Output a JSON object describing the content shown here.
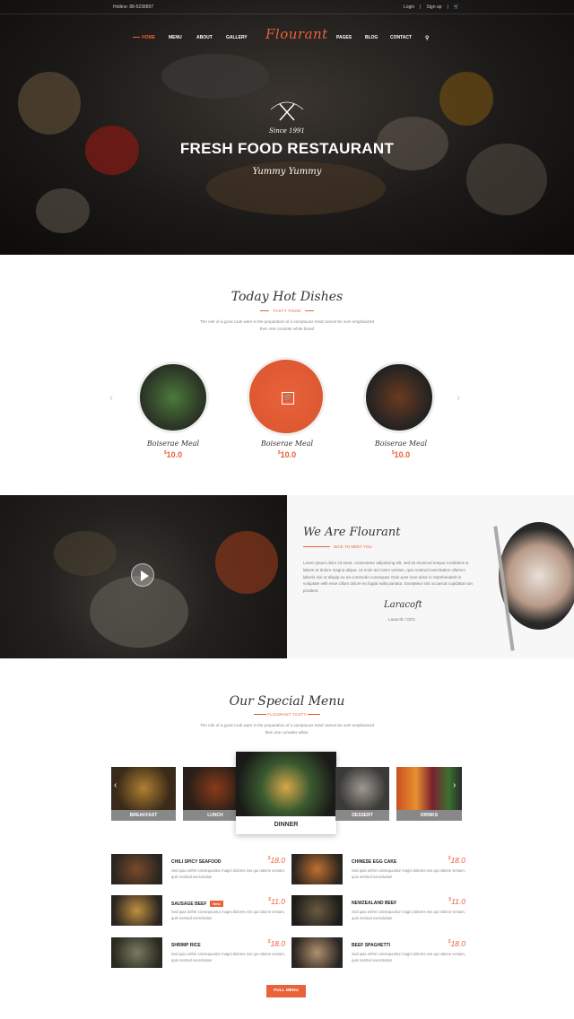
{
  "topbar": {
    "hotline": "Hotline: 88-6238897",
    "login": "Login",
    "signup": "Sign up"
  },
  "nav": {
    "items": [
      "HOME",
      "MENU",
      "ABOUT",
      "GALLERY",
      "PAGES",
      "BLOG",
      "CONTACT"
    ],
    "logo": "Flourant"
  },
  "hero": {
    "since": "Since  1991",
    "title": "FRESH FOOD RESTAURANT",
    "tagline": "Yummy Yummy"
  },
  "hot": {
    "title": "Today Hot Dishes",
    "subtitle": "TASTY FOOD",
    "desc": "The role of a good cook ware in the preparation of a sumptuous meal cannot be over emphasized then one consider white bread",
    "dishes": [
      {
        "name": "Boiserae Meal",
        "price": "10.0",
        "currency": "$"
      },
      {
        "name": "Boiserae Meal",
        "price": "10.0",
        "currency": "$"
      },
      {
        "name": "Boiserae Meal",
        "price": "10.0",
        "currency": "$"
      }
    ]
  },
  "about": {
    "title": "We Are Flourant",
    "subtitle": "NICE TO MEET YOU",
    "text": "Lorem ipsum dolor sit amet, consectetur adipisicing elit, sed do eiusmod tempor incididunt ut labore et dolore magna aliqua. Ut enim ad minim veniam, quis nostrud exercitation ullamco laboris nisi ut aliquip ex ea commodo consequat. Duis aute irure dolor in reprehenderit in voluptate velit esse cillum dolore eu fugiat nulla pariatur. Excepteur sint occaecat cupidatat non proident.",
    "signature": "Laracoft",
    "ceo": "Laracoft / CEO"
  },
  "special": {
    "title": "Our Special Menu",
    "subtitle": "FLOURANT TASTY",
    "desc": "The role of a good cook ware in the preparation of a sumptuous meal cannot be over emphasized then one consider white.",
    "tabs": [
      "BREAKFAST",
      "LUNCH",
      "DINNER",
      "DESSERT",
      "DRINKS"
    ],
    "items": [
      {
        "name": "CHILI SPICY SEAFOOD",
        "price": "18.0",
        "desc": "Sed quia onfret consequuntur magni dolores eos qui ratione veniam, quis nostrud exercitation",
        "new": ""
      },
      {
        "name": "CHINESE EGG CAKE",
        "price": "18.0",
        "desc": "Sed quia onfret consequuntur magni dolores eos qui ratione veniam, quis nostrud exercitation",
        "new": ""
      },
      {
        "name": "SAUSAGE BEEF",
        "price": "11.0",
        "desc": "Sed quia onfret consequuntur magni dolores eos qui ratione veniam, quis nostrud exercitation",
        "new": "New"
      },
      {
        "name": "NEWZEALAND BEEF",
        "price": "11.0",
        "desc": "Sed quia onfret consequuntur magni dolores eos qui ratione veniam, quis nostrud exercitation",
        "new": ""
      },
      {
        "name": "SHRIMP RICE",
        "price": "18.0",
        "desc": "Sed quia onfret consequuntur magni dolores eos qui ratione veniam, quis nostrud exercitation",
        "new": ""
      },
      {
        "name": "BEEF SPAGHETTI",
        "price": "18.0",
        "desc": "Sed quia onfret consequuntur magni dolores eos qui ratione veniam, quis nostrud exercitation",
        "new": ""
      }
    ],
    "currency": "$",
    "button": "FULL MENU"
  },
  "colors": {
    "accent": "#e8623a"
  }
}
